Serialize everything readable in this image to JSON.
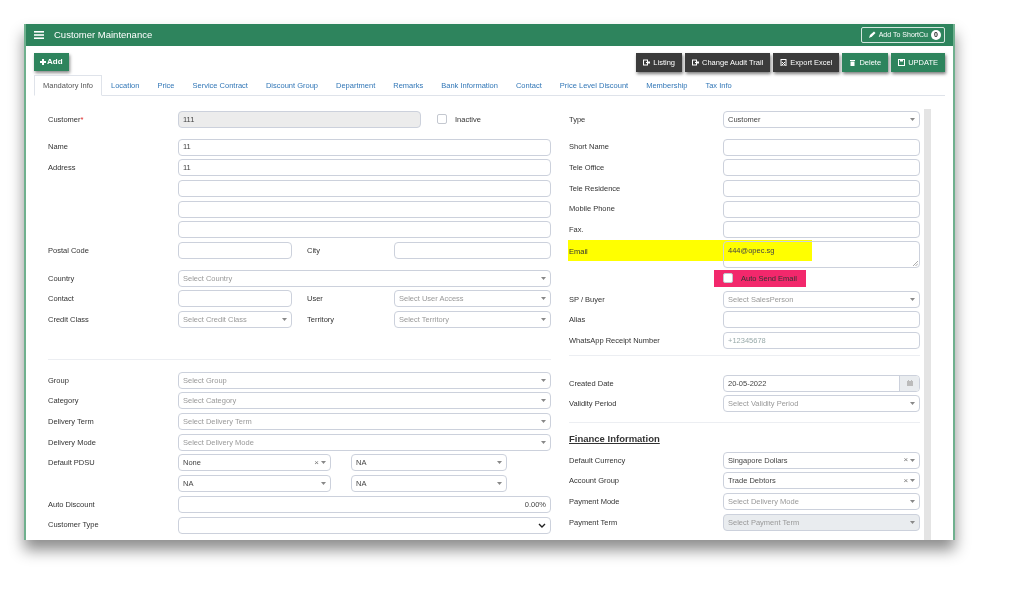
{
  "header": {
    "title": "Customer Maintenance",
    "shortcut_button": "Add To ShortCu",
    "shortcut_count": "0"
  },
  "add_button": "Add",
  "actions": [
    {
      "label": "Listing",
      "kind": "dark"
    },
    {
      "label": "Change Audit Trail",
      "kind": "dark"
    },
    {
      "label": "Export Excel",
      "kind": "dark"
    },
    {
      "label": "Delete",
      "kind": "green"
    },
    {
      "label": "UPDATE",
      "kind": "green"
    }
  ],
  "tabs": [
    {
      "label": "Mandatory Info",
      "selected": true
    },
    {
      "label": "Location",
      "selected": false
    },
    {
      "label": "Price",
      "selected": false
    },
    {
      "label": "Service Contract",
      "selected": false
    },
    {
      "label": "Discount Group",
      "selected": false
    },
    {
      "label": "Department",
      "selected": false
    },
    {
      "label": "Remarks",
      "selected": false
    },
    {
      "label": "Bank Information",
      "selected": false
    },
    {
      "label": "Contact",
      "selected": false
    },
    {
      "label": "Price Level Discount",
      "selected": false
    },
    {
      "label": "Membership",
      "selected": false
    },
    {
      "label": "Tax Info",
      "selected": false
    }
  ],
  "left_column": {
    "sections": [
      [
        [
          {
            "kind": "flag",
            "label": "Customer",
            "required_mark": "*",
            "field": {
              "kind": "readonly",
              "value": "111"
            },
            "checkbox": {
              "label": "Inactive",
              "checked": false
            }
          }
        ],
        [
          {
            "kind": "full",
            "label": "Name",
            "field": {
              "kind": "input",
              "value": "11"
            }
          },
          {
            "kind": "full",
            "label": "Address",
            "field": {
              "kind": "input",
              "value": "11"
            }
          },
          {
            "kind": "full",
            "field": {
              "kind": "input"
            }
          },
          {
            "kind": "full",
            "field": {
              "kind": "input"
            }
          },
          {
            "kind": "full",
            "field": {
              "kind": "input"
            }
          },
          {
            "kind": "pair",
            "label": "Postal Code",
            "field": {
              "kind": "input"
            },
            "label2": "City",
            "field2": {
              "kind": "input"
            }
          }
        ],
        [
          {
            "kind": "full",
            "label": "Country",
            "field": {
              "kind": "select",
              "placeholder": "Select Country"
            }
          },
          {
            "kind": "pair",
            "label": "Contact",
            "field": {
              "kind": "input"
            },
            "label2": "User",
            "field2": {
              "kind": "select",
              "placeholder": "Select User Access"
            }
          },
          {
            "kind": "pair",
            "label": "Credit Class",
            "field": {
              "kind": "select",
              "placeholder": "Select Credit Class"
            },
            "label2": "Territory",
            "field2": {
              "kind": "select",
              "placeholder": "Select Territory"
            }
          }
        ]
      ],
      [
        [
          {
            "kind": "full",
            "label": "Group",
            "field": {
              "kind": "select",
              "placeholder": "Select Group"
            }
          },
          {
            "kind": "full",
            "label": "Category",
            "field": {
              "kind": "select",
              "placeholder": "Select Category"
            }
          },
          {
            "kind": "full",
            "label": "Delivery Term",
            "field": {
              "kind": "select",
              "placeholder": "Select Delivery Term"
            }
          },
          {
            "kind": "full",
            "label": "Delivery Mode",
            "field": {
              "kind": "select",
              "placeholder": "Select Delivery Mode"
            }
          },
          {
            "kind": "quad",
            "label": "Default PDSU",
            "fields": [
              {
                "kind": "select",
                "value": "None",
                "clear": "×"
              },
              {
                "kind": "select",
                "value": "NA"
              }
            ]
          },
          {
            "kind": "quad",
            "fields": [
              {
                "kind": "select",
                "value": "NA"
              },
              {
                "kind": "select",
                "value": "NA"
              }
            ]
          },
          {
            "kind": "full",
            "label": "Auto Discount",
            "field": {
              "kind": "number",
              "value": "0.00%"
            }
          },
          {
            "kind": "full",
            "label": "Customer Type",
            "field": {
              "kind": "native_select"
            }
          }
        ]
      ]
    ]
  },
  "right_column": {
    "sections": [
      [
        [
          {
            "kind": "full",
            "label": "Type",
            "field": {
              "kind": "select",
              "value": "Customer"
            }
          }
        ],
        [
          {
            "kind": "full",
            "label": "Short Name",
            "field": {
              "kind": "input"
            }
          },
          {
            "kind": "full",
            "label": "Tele Office",
            "field": {
              "kind": "input"
            }
          },
          {
            "kind": "full",
            "label": "Tele Residence",
            "field": {
              "kind": "input"
            }
          },
          {
            "kind": "full",
            "label": "Mobile Phone",
            "field": {
              "kind": "input"
            }
          },
          {
            "kind": "full",
            "label": "Fax.",
            "field": {
              "kind": "input"
            }
          },
          {
            "kind": "full",
            "label": "Email",
            "highlighted": true,
            "field": {
              "kind": "textarea",
              "value": "444@opec.sg"
            }
          },
          {
            "kind": "checkbox",
            "checkbox": {
              "label": "Auto Send Email",
              "checked": false,
              "highlighted": true
            }
          },
          {
            "kind": "full",
            "label": "SP / Buyer",
            "field": {
              "kind": "select",
              "placeholder": "Select SalesPerson"
            }
          },
          {
            "kind": "full",
            "label": "Alias",
            "field": {
              "kind": "input"
            }
          },
          {
            "kind": "full",
            "label": "WhatsApp Receipt Number",
            "field": {
              "kind": "input",
              "placeholder": "+12345678"
            }
          }
        ]
      ],
      [
        [
          {
            "kind": "full",
            "label": "Created Date",
            "field": {
              "kind": "date",
              "value": "20-05-2022"
            }
          },
          {
            "kind": "full",
            "label": "Validity Period",
            "field": {
              "kind": "select",
              "placeholder": "Select Validity Period"
            }
          }
        ]
      ],
      [
        [
          {
            "kind": "heading",
            "text": "Finance Information"
          },
          {
            "kind": "full",
            "label": "Default Currency",
            "field": {
              "kind": "select",
              "value": "Singapore Dollars",
              "clear": "×"
            }
          },
          {
            "kind": "full",
            "label": "Account Group",
            "field": {
              "kind": "select",
              "value": "Trade Debtors",
              "clear": "×"
            }
          },
          {
            "kind": "full",
            "label": "Payment Mode",
            "field": {
              "kind": "select",
              "placeholder": "Select Delivery Mode"
            }
          },
          {
            "kind": "full",
            "label": "Payment Term",
            "field": {
              "kind": "select",
              "placeholder": "Select Payment Term",
              "disabled": true
            }
          }
        ]
      ]
    ]
  }
}
